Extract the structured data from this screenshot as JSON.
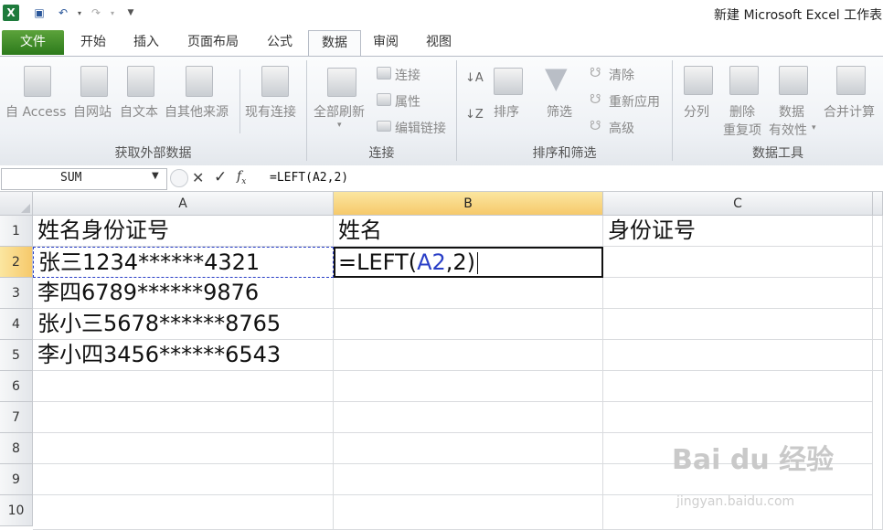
{
  "window": {
    "title": "新建 Microsoft Excel 工作表"
  },
  "tabs": [
    "文件",
    "开始",
    "插入",
    "页面布局",
    "公式",
    "数据",
    "审阅",
    "视图"
  ],
  "active_tab": "数据",
  "ribbon": {
    "external_data": {
      "group_label": "获取外部数据",
      "buttons": [
        "自 Access",
        "自网站",
        "自文本",
        "自其他来源",
        "现有连接"
      ]
    },
    "connections": {
      "group_label": "连接",
      "refresh_label": "全部刷新",
      "small_buttons": [
        "连接",
        "属性",
        "编辑链接"
      ]
    },
    "sort_filter": {
      "group_label": "排序和筛选",
      "sort_label": "排序",
      "filter_label": "筛选",
      "small_buttons": [
        "清除",
        "重新应用",
        "高级"
      ]
    },
    "data_tools": {
      "group_label": "数据工具",
      "text_to_columns": "分列",
      "remove_dup_line1": "删除",
      "remove_dup_line2": "重复项",
      "validation_line1": "数据",
      "validation_line2": "有效性",
      "consolidate": "合并计算"
    }
  },
  "formula_bar": {
    "name_box": "SUM",
    "formula": "=LEFT(A2,2)"
  },
  "columns": [
    "A",
    "B",
    "C"
  ],
  "rows": [
    "1",
    "2",
    "3",
    "4",
    "5",
    "6",
    "7",
    "8",
    "9",
    "10"
  ],
  "cells": {
    "A1": "姓名身份证号",
    "B1": "姓名",
    "C1": "身份证号",
    "A2": "张三1234******4321",
    "A3": "李四6789******9876",
    "A4": "张小三5678******8765",
    "A5": "李小四3456******6543",
    "B2_prefix": "=LEFT(",
    "B2_ref": "A2",
    "B2_suffix": ",2)"
  },
  "watermark": {
    "main": "Bai du 经验",
    "sub": "jingyan.baidu.com"
  },
  "colors": {
    "file_tab": "#3e8f2a",
    "selected_header": "#f6c96b",
    "reference_blue": "#2a3fc7"
  }
}
